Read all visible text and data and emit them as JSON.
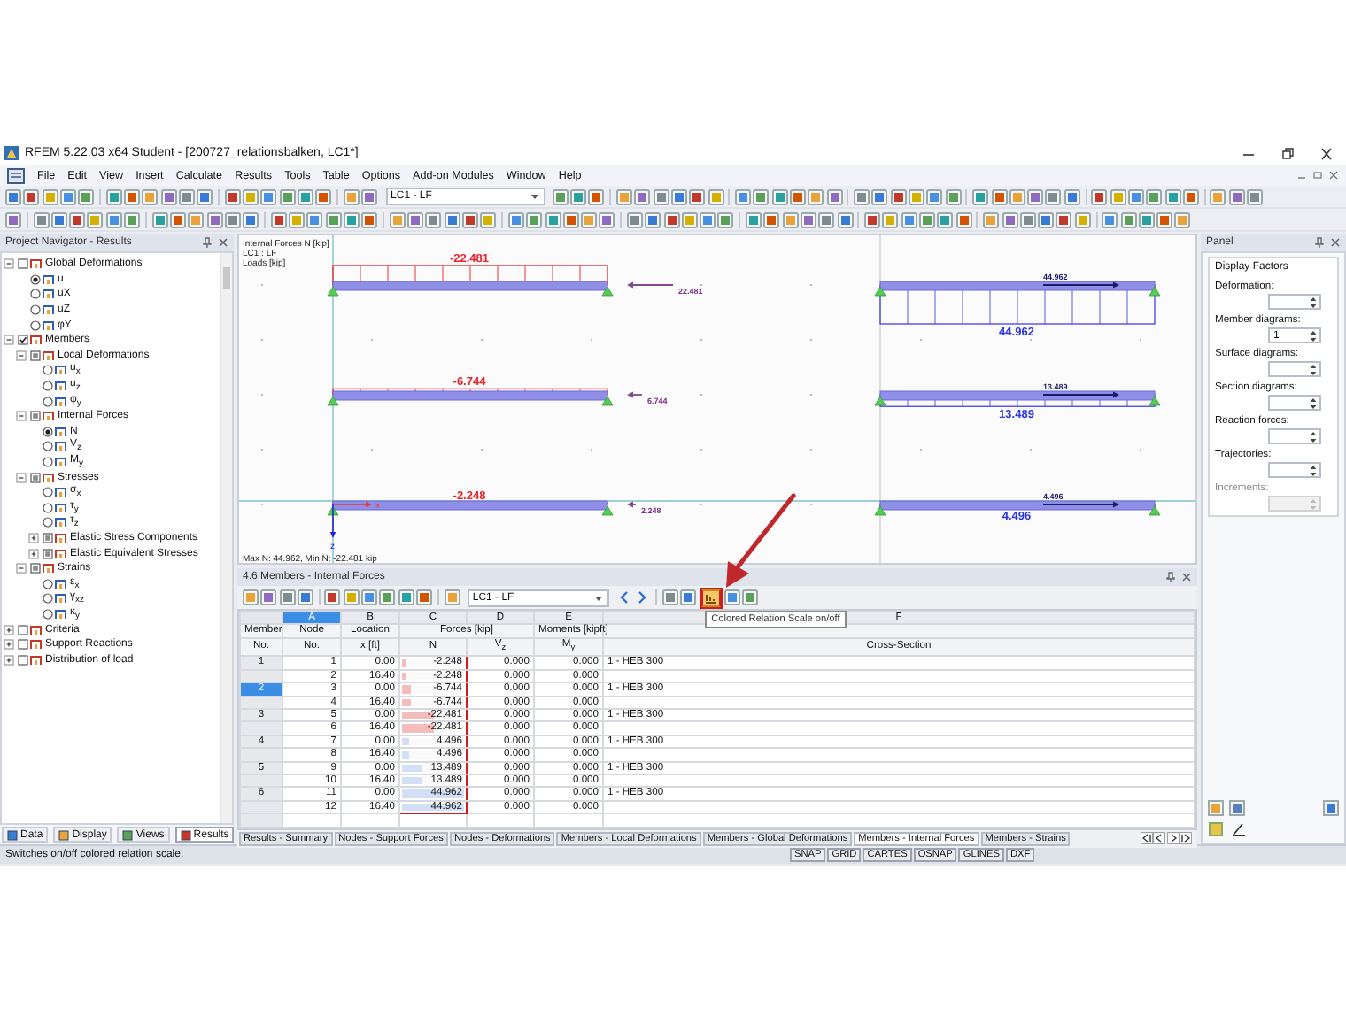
{
  "window": {
    "title": "RFEM 5.22.03 x64 Student - [200727_relationsbalken, LC1*]"
  },
  "menu": [
    "File",
    "Edit",
    "View",
    "Insert",
    "Calculate",
    "Results",
    "Tools",
    "Table",
    "Options",
    "Add-on Modules",
    "Window",
    "Help"
  ],
  "toolbar": {
    "loadcase": "LC1 - LF"
  },
  "navigator": {
    "title": "Project Navigator - Results",
    "tree": [
      {
        "kind": "checkbox",
        "label": "Global Deformations",
        "checked": false,
        "partial": false,
        "expanded": true,
        "children": [
          {
            "kind": "radio",
            "label": "u",
            "selected": true
          },
          {
            "kind": "radio",
            "label": "uX",
            "selected": false
          },
          {
            "kind": "radio",
            "label": "uZ",
            "selected": false
          },
          {
            "kind": "radio",
            "label": "φY",
            "selected": false
          }
        ]
      },
      {
        "kind": "checkbox",
        "label": "Members",
        "checked": true,
        "partial": false,
        "expanded": true,
        "children": [
          {
            "kind": "checkbox",
            "label": "Local Deformations",
            "checked": false,
            "partial": true,
            "expanded": true,
            "children": [
              {
                "kind": "radio",
                "label": "u$_{x}$",
                "selected": false
              },
              {
                "kind": "radio",
                "label": "u$_{z}$",
                "selected": false
              },
              {
                "kind": "radio",
                "label": "φ$_{y}$",
                "selected": false
              }
            ]
          },
          {
            "kind": "checkbox",
            "label": "Internal Forces",
            "checked": false,
            "partial": true,
            "expanded": true,
            "children": [
              {
                "kind": "radio",
                "label": "N",
                "selected": true
              },
              {
                "kind": "radio",
                "label": "V$_{z}$",
                "selected": false
              },
              {
                "kind": "radio",
                "label": "M$_{y}$",
                "selected": false
              }
            ]
          },
          {
            "kind": "checkbox",
            "label": "Stresses",
            "checked": false,
            "partial": true,
            "expanded": true,
            "children": [
              {
                "kind": "radio",
                "label": "σ$_{x}$",
                "selected": false
              },
              {
                "kind": "radio",
                "label": "τ$_{y}$",
                "selected": false
              },
              {
                "kind": "radio",
                "label": "τ$_{z}$",
                "selected": false
              },
              {
                "kind": "checkbox",
                "label": "Elastic Stress Components",
                "checked": false,
                "partial": true,
                "expanded": false
              },
              {
                "kind": "checkbox",
                "label": "Elastic Equivalent Stresses",
                "checked": false,
                "partial": true,
                "expanded": false
              }
            ]
          },
          {
            "kind": "checkbox",
            "label": "Strains",
            "checked": false,
            "partial": true,
            "expanded": true,
            "children": [
              {
                "kind": "radio",
                "label": "ε$_{x}$",
                "selected": false
              },
              {
                "kind": "radio",
                "label": "γ$_{xz}$",
                "selected": false
              },
              {
                "kind": "radio",
                "label": "κ$_{y}$",
                "selected": false
              }
            ]
          }
        ]
      },
      {
        "kind": "checkbox",
        "label": "Criteria",
        "checked": false,
        "partial": false,
        "expanded": false
      },
      {
        "kind": "checkbox",
        "label": "Support Reactions",
        "checked": false,
        "partial": false,
        "expanded": false
      },
      {
        "kind": "checkbox",
        "label": "Distribution of load",
        "checked": false,
        "partial": false,
        "expanded": false
      }
    ],
    "tabs": [
      {
        "label": "Data",
        "selected": false
      },
      {
        "label": "Display",
        "selected": false
      },
      {
        "label": "Views",
        "selected": false
      },
      {
        "label": "Results",
        "selected": true
      }
    ]
  },
  "graphic": {
    "legend": [
      "Internal Forces N [kip]",
      "LC1 : LF",
      "Loads [kip]"
    ],
    "members": [
      {
        "kind": "compression",
        "value": "-22.481",
        "load": "22.481"
      },
      {
        "kind": "compression",
        "value": "-6.744",
        "load": "6.744"
      },
      {
        "kind": "compression",
        "value": "-2.248",
        "load": "2.248"
      },
      {
        "kind": "tension",
        "value": "44.962",
        "load": "44.962"
      },
      {
        "kind": "tension",
        "value": "13.489",
        "load": "13.489"
      },
      {
        "kind": "tension",
        "value": "4.496",
        "load": "4.496"
      }
    ],
    "axes": {
      "x": "x",
      "z": "z"
    },
    "summary": "Max N: 44.962, Min N: -22.481 kip"
  },
  "table": {
    "title": "4.6 Members - Internal Forces",
    "toolbar": {
      "loadcase": "LC1 - LF",
      "relation_scale": {
        "on": true,
        "highlighted": true,
        "tooltip": "Colored Relation Scale on/off"
      }
    },
    "row_header": {
      "title": "Member",
      "subtitle": "No."
    },
    "columns": [
      {
        "letter": "A",
        "selected": true,
        "kind": "number",
        "title": "Node",
        "subtitle": "No."
      },
      {
        "letter": "B",
        "selected": false,
        "kind": "number",
        "title": "Location",
        "subtitle": "x [ft]"
      },
      {
        "letter": "C",
        "selected": false,
        "kind": "relation",
        "title": "Forces [kip]",
        "subtitle": "N",
        "highlighted": true
      },
      {
        "letter": "D",
        "selected": false,
        "kind": "number",
        "joined": true,
        "subtitle": "V$_{z}$"
      },
      {
        "letter": "E",
        "selected": false,
        "kind": "number",
        "title": "Moments [kipft]",
        "subtitle": "M$_{y}$"
      },
      {
        "letter": "F",
        "selected": false,
        "kind": "text",
        "subtitle": "Cross-Section"
      }
    ],
    "rows": [
      {
        "member": "1",
        "selected": false,
        "cells": [
          "1",
          "0.00",
          "-2.248",
          "0.000",
          "0.000",
          "1 - HEB 300"
        ],
        "level": 0.05,
        "color": "#f5bcbc"
      },
      {
        "selected": false,
        "cells": [
          "2",
          "16.40",
          "-2.248",
          "0.000",
          "0.000"
        ],
        "level": 0.05,
        "color": "#f5bcbc"
      },
      {
        "member": "2",
        "selected": true,
        "cells": [
          "3",
          "0.00",
          "-6.744",
          "0.000",
          "0.000",
          "1 - HEB 300"
        ],
        "level": 0.15,
        "color": "#f5bcbc"
      },
      {
        "selected": false,
        "cells": [
          "4",
          "16.40",
          "-6.744",
          "0.000",
          "0.000"
        ],
        "level": 0.15,
        "color": "#f5bcbc"
      },
      {
        "member": "3",
        "selected": false,
        "cells": [
          "5",
          "0.00",
          "-22.481",
          "0.000",
          "0.000",
          "1 - HEB 300"
        ],
        "level": 0.5,
        "color": "#f5bcbc"
      },
      {
        "selected": false,
        "cells": [
          "6",
          "16.40",
          "-22.481",
          "0.000",
          "0.000"
        ],
        "level": 0.5,
        "color": "#f5bcbc"
      },
      {
        "member": "4",
        "selected": false,
        "cells": [
          "7",
          "0.00",
          "4.496",
          "0.000",
          "0.000",
          "1 - HEB 300"
        ],
        "level": 0.1,
        "color": "#d3dff5"
      },
      {
        "selected": false,
        "cells": [
          "8",
          "16.40",
          "4.496",
          "0.000",
          "0.000"
        ],
        "level": 0.1,
        "color": "#d3dff5"
      },
      {
        "member": "5",
        "selected": false,
        "cells": [
          "9",
          "0.00",
          "13.489",
          "0.000",
          "0.000",
          "1 - HEB 300"
        ],
        "level": 0.3,
        "color": "#d3dff5"
      },
      {
        "selected": false,
        "cells": [
          "10",
          "16.40",
          "13.489",
          "0.000",
          "0.000"
        ],
        "level": 0.3,
        "color": "#d3dff5"
      },
      {
        "member": "6",
        "selected": false,
        "cells": [
          "11",
          "0.00",
          "44.962",
          "0.000",
          "0.000",
          "1 - HEB 300"
        ],
        "level": 1,
        "color": "#d3dff5"
      },
      {
        "selected": false,
        "cells": [
          "12",
          "16.40",
          "44.962",
          "0.000",
          "0.000"
        ],
        "level": 1,
        "color": "#d3dff5"
      }
    ],
    "tabs": [
      {
        "label": "Results - Summary",
        "selected": false
      },
      {
        "label": "Nodes - Support Forces",
        "selected": false
      },
      {
        "label": "Nodes - Deformations",
        "selected": false
      },
      {
        "label": "Members - Local Deformations",
        "selected": false
      },
      {
        "label": "Members - Global Deformations",
        "selected": false
      },
      {
        "label": "Members - Internal Forces",
        "selected": true
      },
      {
        "label": "Members - Strains",
        "selected": false
      }
    ]
  },
  "callout": {
    "kind": "arrow"
  },
  "panel": {
    "title": "Panel",
    "group": "Display Factors",
    "factors": [
      {
        "label": "Deformation:"
      },
      {
        "label": "Member diagrams:",
        "value": "1"
      },
      {
        "label": "Surface diagrams:"
      },
      {
        "label": "Section diagrams:"
      },
      {
        "label": "Reaction forces:"
      },
      {
        "label": "Trajectories:"
      },
      {
        "label": "Increments:",
        "disabled": true
      }
    ]
  },
  "status": {
    "message": "Switches on/off colored relation scale.",
    "toggles": [
      "SNAP",
      "GRID",
      "CARTES",
      "OSNAP",
      "GLINES",
      "DXF"
    ]
  }
}
